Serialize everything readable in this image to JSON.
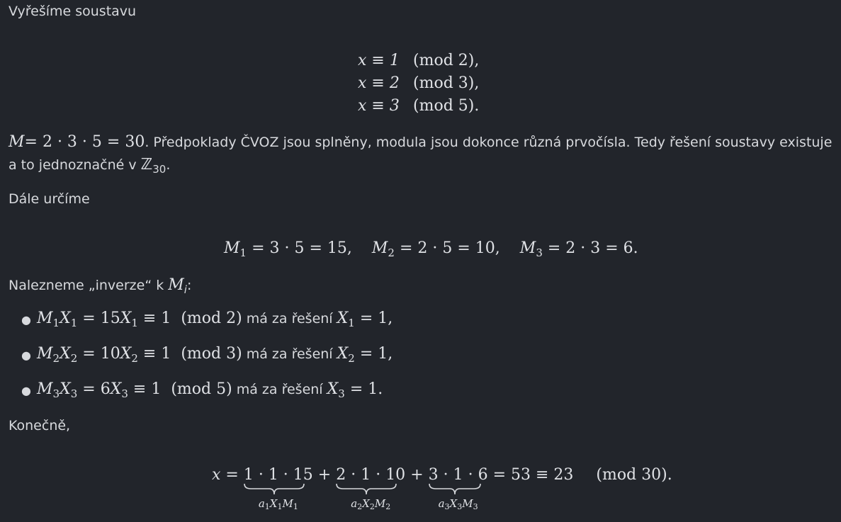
{
  "intro": "Vyřešíme soustavu",
  "system": [
    {
      "lhs": "x ≡ 1",
      "rhs": "(mod  2),"
    },
    {
      "lhs": "x ≡ 2",
      "rhs": "(mod  3),"
    },
    {
      "lhs": "x ≡ 3",
      "rhs": "(mod  5)."
    }
  ],
  "modulus_line": {
    "formula": "= 2 · 3 · 5 = 30",
    "text1": ". Předpoklady ČVOZ jsou splněny, modula jsou dokonce různá prvočísla. Tedy řešení soustavy existuje",
    "text2": "a to jednoznačné v ",
    "ring_sub": "30",
    "text2_end": "."
  },
  "dale": "Dále určíme",
  "partials": [
    {
      "sub": "1",
      "expr": "= 3 · 5 = 15,"
    },
    {
      "sub": "2",
      "expr": "= 2 · 5 = 10,"
    },
    {
      "sub": "3",
      "expr": "= 2 · 3 = 6."
    }
  ],
  "inverse_intro": {
    "text": "Nalezneme „inverze“ k ",
    "end": ":"
  },
  "inverses": [
    {
      "i": "1",
      "coef": "15",
      "mod": "(mod  2)",
      "text": " má za řešení ",
      "val": "= 1,"
    },
    {
      "i": "2",
      "coef": "10",
      "mod": "(mod  3)",
      "text": " má za řešení ",
      "val": "= 1,"
    },
    {
      "i": "3",
      "coef": "6",
      "mod": "(mod  5)",
      "text": " má za řešení ",
      "val": "= 1."
    }
  ],
  "finally": "Konečně,",
  "final_eq": {
    "lhs": "x =",
    "terms": [
      {
        "expr": "1 · 1 · 15",
        "label_i": "1"
      },
      {
        "expr": "2 · 1 · 10",
        "label_i": "2"
      },
      {
        "expr": "3 · 1 · 6",
        "label_i": "3"
      }
    ],
    "rhs": "= 53 ≡ 23",
    "mod": "(mod  30)."
  }
}
